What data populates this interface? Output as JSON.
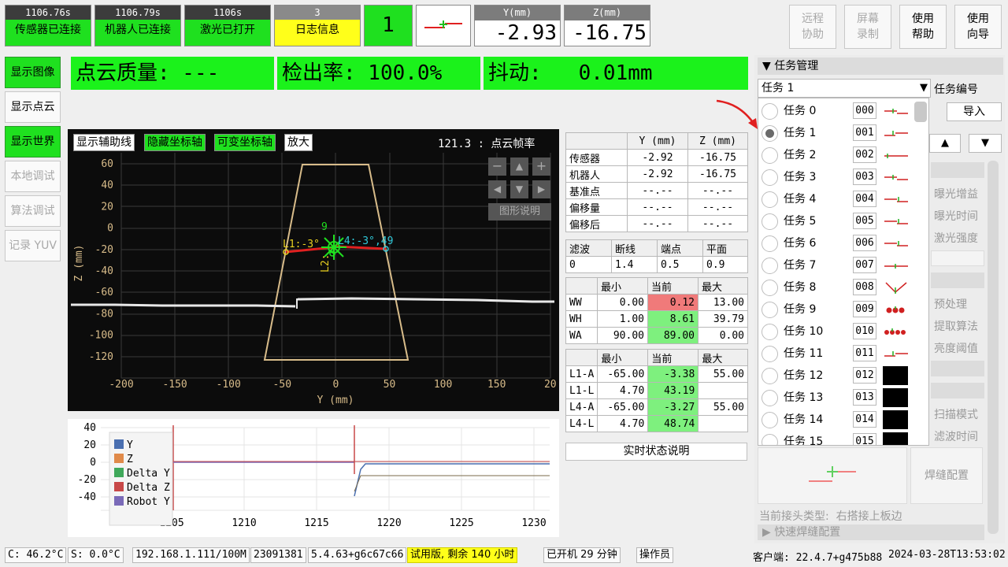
{
  "top_tiles": [
    {
      "time": "1106.76s",
      "label": "传感器已连接"
    },
    {
      "time": "1106.79s",
      "label": "机器人已连接"
    },
    {
      "time": "1106s",
      "label": "激光已打开"
    },
    {
      "time": "3",
      "label": "日志信息"
    }
  ],
  "task_number": "1",
  "readouts": {
    "y_label": "Y(mm)",
    "y_value": "-2.93",
    "z_label": "Z(mm)",
    "z_value": "-16.75"
  },
  "right_buttons": [
    {
      "label": "远程\n协助",
      "enabled": false
    },
    {
      "label": "屏幕\n录制",
      "enabled": false
    },
    {
      "label": "使用\n帮助",
      "enabled": true
    },
    {
      "label": "使用\n向导",
      "enabled": true
    }
  ],
  "left_nav": [
    {
      "label": "显示图像",
      "active": true,
      "enabled": true
    },
    {
      "label": "显示点云",
      "active": false,
      "enabled": true
    },
    {
      "label": "显示世界",
      "active": true,
      "enabled": true
    },
    {
      "label": "本地调试",
      "active": false,
      "enabled": false
    },
    {
      "label": "算法调试",
      "active": false,
      "enabled": false
    },
    {
      "label": "记录 YUV",
      "active": false,
      "enabled": false
    }
  ],
  "quality": {
    "cloud": "点云质量: ---",
    "detect": "检出率: 100.0%",
    "jitter": "抖动:   0.01mm"
  },
  "plot": {
    "buttons": [
      "显示辅助线",
      "隐藏坐标轴",
      "可变坐标轴",
      "放大"
    ],
    "fps": "121.3 : 点云帧率",
    "legend_button": "图形说明",
    "xlabel": "Y (mm)",
    "ylabel": "Z (mm)",
    "x_ticks": [
      "-200",
      "-150",
      "-100",
      "-50",
      "0",
      "50",
      "100",
      "150",
      "20"
    ],
    "y_ticks": [
      "60",
      "40",
      "20",
      "0",
      "-20",
      "-40",
      "-60",
      "-80",
      "-100",
      "-120"
    ],
    "annot_l1": "L1:-3°",
    "annot_l4": "L4:-3°,49",
    "annot_l2": "L2:",
    "annot_9": "9"
  },
  "chart_data": {
    "type": "line",
    "x_ticks": [
      "1205",
      "1210",
      "1215",
      "1220",
      "1225",
      "1230"
    ],
    "y_ticks": [
      "40",
      "20",
      "0",
      "-20",
      "-40"
    ],
    "series": [
      {
        "name": "Y",
        "color": "#4a6fb0"
      },
      {
        "name": "Z",
        "color": "#e08a4a"
      },
      {
        "name": "Delta Y",
        "color": "#3fa85a"
      },
      {
        "name": "Delta Z",
        "color": "#c84848"
      },
      {
        "name": "Robot Y",
        "color": "#7a6ab8"
      }
    ]
  },
  "coord_table": {
    "headers": [
      "",
      "Y (mm)",
      "Z (mm)"
    ],
    "rows": [
      [
        "传感器",
        "-2.92",
        "-16.75"
      ],
      [
        "机器人",
        "-2.92",
        "-16.75"
      ],
      [
        "基准点",
        "--.--",
        "--.--"
      ],
      [
        "偏移量",
        "--.--",
        "--.--"
      ],
      [
        "偏移后",
        "--.--",
        "--.--"
      ]
    ]
  },
  "filter_table": {
    "headers": [
      "滤波",
      "断线",
      "端点",
      "平面"
    ],
    "values": [
      "0",
      "1.4",
      "0.5",
      "0.9"
    ]
  },
  "w_table": {
    "headers": [
      "",
      "最小",
      "当前",
      "最大"
    ],
    "rows": [
      [
        "WW",
        "0.00",
        "0.12",
        "13.00"
      ],
      [
        "WH",
        "1.00",
        "8.61",
        "39.79"
      ],
      [
        "WA",
        "90.00",
        "89.00",
        "0.00"
      ]
    ]
  },
  "l_table": {
    "headers": [
      "",
      "最小",
      "当前",
      "最大"
    ],
    "rows": [
      [
        "L1-A",
        "-65.00",
        "-3.38",
        "55.00"
      ],
      [
        "L1-L",
        "4.70",
        "43.19",
        ""
      ],
      [
        "L4-A",
        "-65.00",
        "-3.27",
        "55.00"
      ],
      [
        "L4-L",
        "4.70",
        "48.74",
        ""
      ]
    ]
  },
  "realtime_button": "实时状态说明",
  "task_panel": {
    "title": "▼ 任务管理",
    "selected": "任务 1",
    "task_no_label": "任务编号",
    "import_label": "导入",
    "tasks": [
      {
        "label": "任务 0",
        "code": "000"
      },
      {
        "label": "任务 1",
        "code": "001"
      },
      {
        "label": "任务 2",
        "code": "002"
      },
      {
        "label": "任务 3",
        "code": "003"
      },
      {
        "label": "任务 4",
        "code": "004"
      },
      {
        "label": "任务 5",
        "code": "005"
      },
      {
        "label": "任务 6",
        "code": "006"
      },
      {
        "label": "任务 7",
        "code": "007"
      },
      {
        "label": "任务 8",
        "code": "008"
      },
      {
        "label": "任务 9",
        "code": "009"
      },
      {
        "label": "任务 10",
        "code": "010"
      },
      {
        "label": "任务 11",
        "code": "011"
      },
      {
        "label": "任务 12",
        "code": "012"
      },
      {
        "label": "任务 13",
        "code": "013"
      },
      {
        "label": "任务 14",
        "code": "014"
      },
      {
        "label": "任务 15",
        "code": "015"
      }
    ],
    "side_labels": [
      "曝光增益",
      "曝光时间",
      "激光强度",
      "预处理",
      "提取算法",
      "亮度阈值",
      "扫描模式",
      "滤波时间"
    ],
    "weld_config": "焊缝配置",
    "joint_type": "当前接头类型:  右搭接上板边",
    "quick_weld": "▶ 快速焊缝配置"
  },
  "status_bar": {
    "c_temp": "C: 46.2°C",
    "s_temp": "S:  0.0°C",
    "ip": "192.168.1.111/100M",
    "serial": "23091381",
    "version": "5.4.63+g6c67c66",
    "trial": "试用版, 剩余 140 小时",
    "uptime": "已开机 29 分钟",
    "role": "操作员",
    "client": "客户端: 22.4.7+g475b88",
    "datetime": "2024-03-28T13:53:02"
  }
}
